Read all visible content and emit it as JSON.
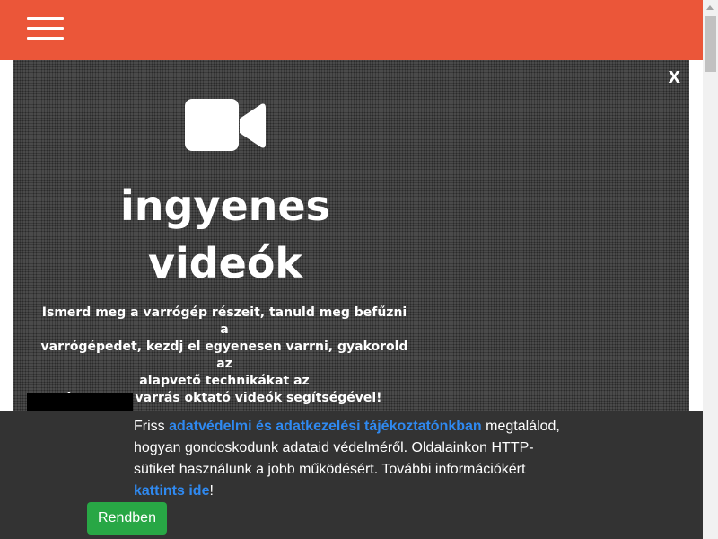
{
  "header": {
    "menu_icon": "hamburger-menu-icon",
    "background_color": "#eb5639"
  },
  "hero": {
    "close_label": "x",
    "icon": "video-camera-icon",
    "title_line1": "ingyenes",
    "title_line2": "videók",
    "desc_line1": "Ismerd meg a varrógép részeit, tanuld meg befűzni a",
    "desc_line2": "varrógépedet, kezdj el egyenesen varrni, gyakorold az",
    "desc_line3": "alapvető technikákat az",
    "desc_line4": "ingyenes varrás oktató videók segítségével!"
  },
  "cookie": {
    "text_prefix": "Friss ",
    "policy_link": "adatvédelmi és adatkezelési tájékoztatónkban",
    "text_middle": " megtalálod, hogyan gondoskodunk adataid védelméről. Oldalainkon HTTP-sütiket használunk a jobb működésért. További információkért ",
    "more_link": "kattints ide",
    "text_suffix": "!",
    "button_label": "Rendben",
    "link_color": "#2f89f0",
    "button_color": "#28a745"
  }
}
